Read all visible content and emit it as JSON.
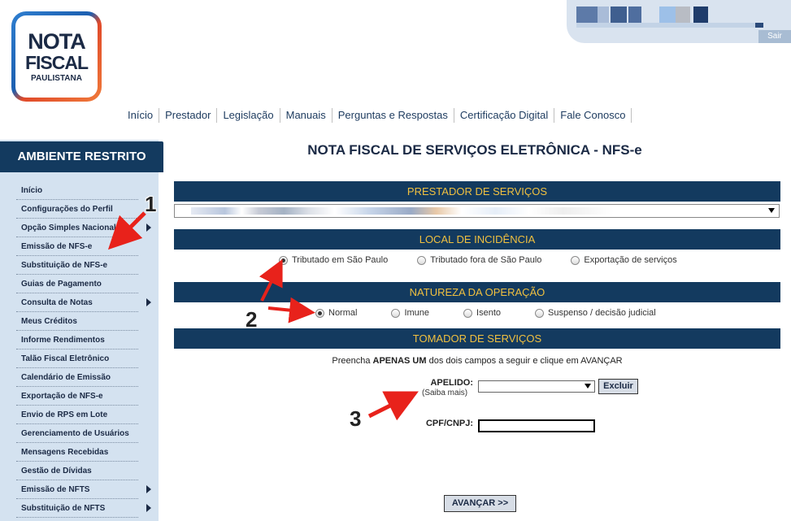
{
  "logo": {
    "line1": "NOTA",
    "line2": "FISCAL",
    "line3": "PAULISTANA"
  },
  "user_panel": {
    "logout_label": "Sair"
  },
  "topnav": [
    {
      "label": "Início"
    },
    {
      "label": "Prestador"
    },
    {
      "label": "Legislação"
    },
    {
      "label": "Manuais"
    },
    {
      "label": "Perguntas e Respostas"
    },
    {
      "label": "Certificação Digital"
    },
    {
      "label": "Fale Conosco"
    }
  ],
  "sidebar": {
    "title": "AMBIENTE RESTRITO",
    "items": [
      {
        "label": "Início",
        "submenu": false
      },
      {
        "label": "Configurações do Perfil",
        "submenu": false
      },
      {
        "label": "Opção Simples Nacional",
        "submenu": true
      },
      {
        "label": "Emissão de NFS-e",
        "submenu": false
      },
      {
        "label": "Substituição de NFS-e",
        "submenu": false
      },
      {
        "label": "Guias de Pagamento",
        "submenu": false
      },
      {
        "label": "Consulta de Notas",
        "submenu": true
      },
      {
        "label": "Meus Créditos",
        "submenu": false
      },
      {
        "label": "Informe Rendimentos",
        "submenu": false
      },
      {
        "label": "Talão Fiscal Eletrônico",
        "submenu": false
      },
      {
        "label": "Calendário de Emissão",
        "submenu": false
      },
      {
        "label": "Exportação de NFS-e",
        "submenu": false
      },
      {
        "label": "Envio de RPS em Lote",
        "submenu": false
      },
      {
        "label": "Gerenciamento de Usuários",
        "submenu": false
      },
      {
        "label": "Mensagens Recebidas",
        "submenu": false
      },
      {
        "label": "Gestão de Dívidas",
        "submenu": false
      },
      {
        "label": "Emissão de NFTS",
        "submenu": true
      },
      {
        "label": "Substituição de NFTS",
        "submenu": true
      }
    ]
  },
  "main": {
    "title": "NOTA FISCAL DE SERVIÇOS ELETRÔNICA - NFS-e",
    "prestador": {
      "heading": "PRESTADOR DE SERVIÇOS"
    },
    "local": {
      "heading": "LOCAL DE INCIDÊNCIA",
      "options": [
        {
          "label": "Tributado em São Paulo",
          "selected": true
        },
        {
          "label": "Tributado fora de São Paulo",
          "selected": false
        },
        {
          "label": "Exportação de serviços",
          "selected": false
        }
      ]
    },
    "natureza": {
      "heading": "NATUREZA DA OPERAÇÃO",
      "options": [
        {
          "label": "Normal",
          "selected": true
        },
        {
          "label": "Imune",
          "selected": false
        },
        {
          "label": "Isento",
          "selected": false
        },
        {
          "label": "Suspenso / decisão judicial",
          "selected": false
        }
      ]
    },
    "tomador": {
      "heading": "TOMADOR DE SERVIÇOS",
      "instr_pre": "Preencha",
      "instr_bold": "APENAS UM",
      "instr_post": "dos dois campos a seguir e clique em AVANÇAR",
      "apelido_label": "APELIDO:",
      "saiba_mais": "(Saiba mais)",
      "excluir_label": "Excluir",
      "cpf_label": "CPF/CNPJ:",
      "avancar_label": "AVANÇAR >>"
    }
  },
  "annotations": [
    "1",
    "2",
    "3"
  ],
  "colors": {
    "navy": "#133a5f",
    "bar_text": "#f0c040",
    "sidebar_bg": "#d4e2f0",
    "arrow_red": "#e8221b"
  }
}
